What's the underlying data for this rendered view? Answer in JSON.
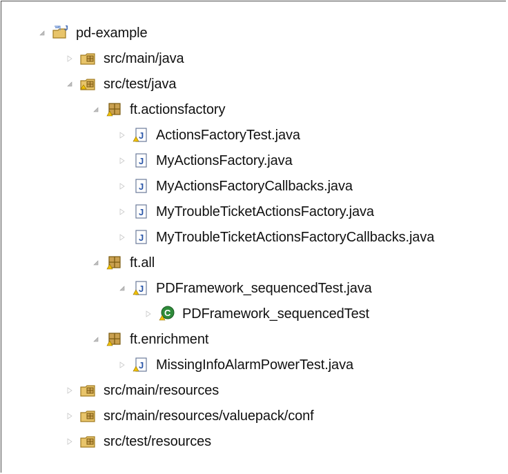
{
  "tree": {
    "nodes": [
      {
        "label": "pd-example",
        "icon": "java-project-icon",
        "toggle": "expanded"
      },
      {
        "label": "src/main/java",
        "icon": "source-folder-icon",
        "toggle": "collapsed"
      },
      {
        "label": "src/test/java",
        "icon": "source-folder-icon",
        "toggle": "expanded"
      },
      {
        "label": "ft.actionsfactory",
        "icon": "package-icon",
        "toggle": "expanded"
      },
      {
        "label": "ActionsFactoryTest.java",
        "icon": "java-file-warning-icon",
        "toggle": "collapsed"
      },
      {
        "label": "MyActionsFactory.java",
        "icon": "java-file-icon",
        "toggle": "collapsed"
      },
      {
        "label": "MyActionsFactoryCallbacks.java",
        "icon": "java-file-icon",
        "toggle": "collapsed"
      },
      {
        "label": "MyTroubleTicketActionsFactory.java",
        "icon": "java-file-icon",
        "toggle": "collapsed"
      },
      {
        "label": "MyTroubleTicketActionsFactoryCallbacks.java",
        "icon": "java-file-icon",
        "toggle": "collapsed"
      },
      {
        "label": "ft.all",
        "icon": "package-icon",
        "toggle": "expanded"
      },
      {
        "label": "PDFramework_sequencedTest.java",
        "icon": "java-file-warning-icon",
        "toggle": "expanded"
      },
      {
        "label": "PDFramework_sequencedTest",
        "icon": "class-warning-icon",
        "toggle": "collapsed"
      },
      {
        "label": "ft.enrichment",
        "icon": "package-icon",
        "toggle": "expanded"
      },
      {
        "label": "MissingInfoAlarmPowerTest.java",
        "icon": "java-file-warning-icon",
        "toggle": "collapsed"
      },
      {
        "label": "src/main/resources",
        "icon": "source-folder-icon",
        "toggle": "collapsed"
      },
      {
        "label": "src/main/resources/valuepack/conf",
        "icon": "source-folder-icon",
        "toggle": "collapsed"
      },
      {
        "label": "src/test/resources",
        "icon": "source-folder-icon",
        "toggle": "collapsed"
      }
    ]
  },
  "colors": {
    "folder_fill": "#e8c46a",
    "folder_edge": "#a07a20",
    "package_fill": "#c9a050",
    "java_letter": "#2a56a8",
    "warning": "#f0c000",
    "class_green": "#2e8b3a",
    "toggle_arrow": "#bfbfbf"
  }
}
